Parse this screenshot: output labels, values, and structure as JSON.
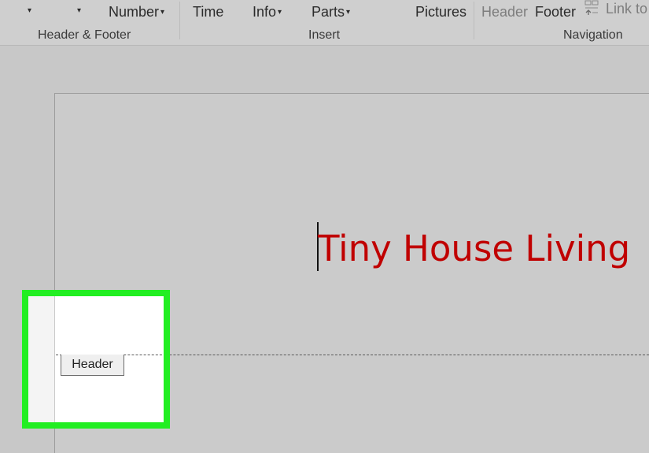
{
  "ribbon": {
    "items": {
      "first_caret": "▾",
      "second_caret": "▾",
      "number": "Number",
      "time": "Time",
      "info": "Info",
      "parts": "Parts",
      "pictures": "Pictures",
      "header": "Header",
      "footer": "Footer",
      "link_to": "Link to"
    },
    "caret": "▾",
    "groups": {
      "header_footer": "Header & Footer",
      "insert": "Insert",
      "navigation": "Navigation"
    }
  },
  "document": {
    "title": "Tiny House Living",
    "title_color": "#c00000",
    "header_tab_label": "Header"
  },
  "highlight_color": "#22ee22"
}
